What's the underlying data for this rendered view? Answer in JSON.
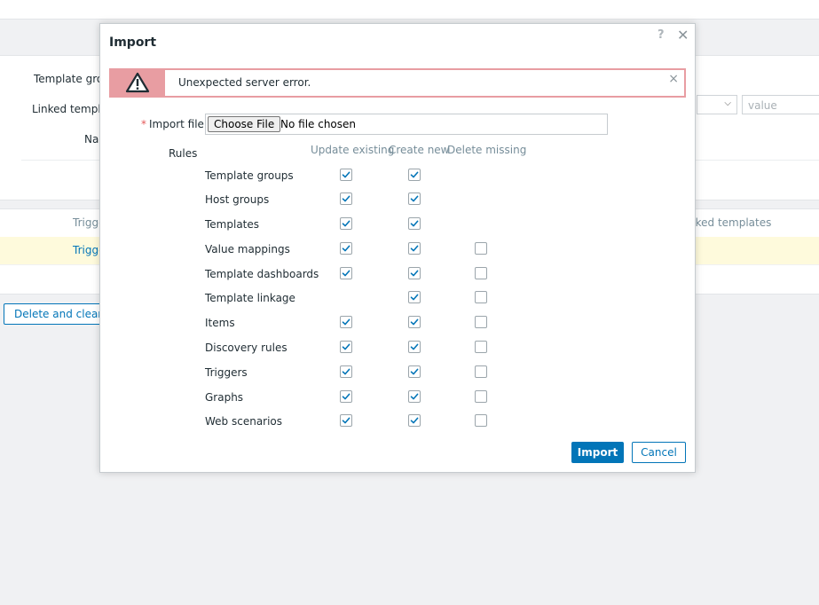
{
  "background": {
    "filter": {
      "template_groups_label": "Template grou",
      "linked_templates_label": "Linked templat",
      "name_label": "Nar",
      "value_placeholder": "value"
    },
    "table": {
      "col_triggers": "Trigge",
      "col_linked_templates": "nked templates",
      "row_trigger": "Trigge"
    },
    "delete_and_clear_label": "Delete and clear"
  },
  "modal": {
    "title": "Import",
    "help_glyph": "?",
    "close_glyph": "✕",
    "error": {
      "message": "Unexpected server error.",
      "close_glyph": "×"
    },
    "import_file": {
      "required_mark": "*",
      "label": "Import file",
      "button_label": "Choose File",
      "status": "No file chosen"
    },
    "rules": {
      "label": "Rules",
      "columns": [
        "Update existing",
        "Create new",
        "Delete missing"
      ],
      "rows": [
        {
          "name": "Template groups",
          "update": true,
          "create": true,
          "delete": null
        },
        {
          "name": "Host groups",
          "update": true,
          "create": true,
          "delete": null
        },
        {
          "name": "Templates",
          "update": true,
          "create": true,
          "delete": null
        },
        {
          "name": "Value mappings",
          "update": true,
          "create": true,
          "delete": false
        },
        {
          "name": "Template dashboards",
          "update": true,
          "create": true,
          "delete": false
        },
        {
          "name": "Template linkage",
          "update": null,
          "create": true,
          "delete": false
        },
        {
          "name": "Items",
          "update": true,
          "create": true,
          "delete": false
        },
        {
          "name": "Discovery rules",
          "update": true,
          "create": true,
          "delete": false
        },
        {
          "name": "Triggers",
          "update": true,
          "create": true,
          "delete": false
        },
        {
          "name": "Graphs",
          "update": true,
          "create": true,
          "delete": false
        },
        {
          "name": "Web scenarios",
          "update": true,
          "create": true,
          "delete": false
        }
      ]
    },
    "import_button_label": "Import",
    "cancel_button_label": "Cancel"
  },
  "colors": {
    "primary": "#0275b8",
    "error_border": "#e89da2",
    "required": "#e45959",
    "highlight_row": "#fefadc"
  }
}
